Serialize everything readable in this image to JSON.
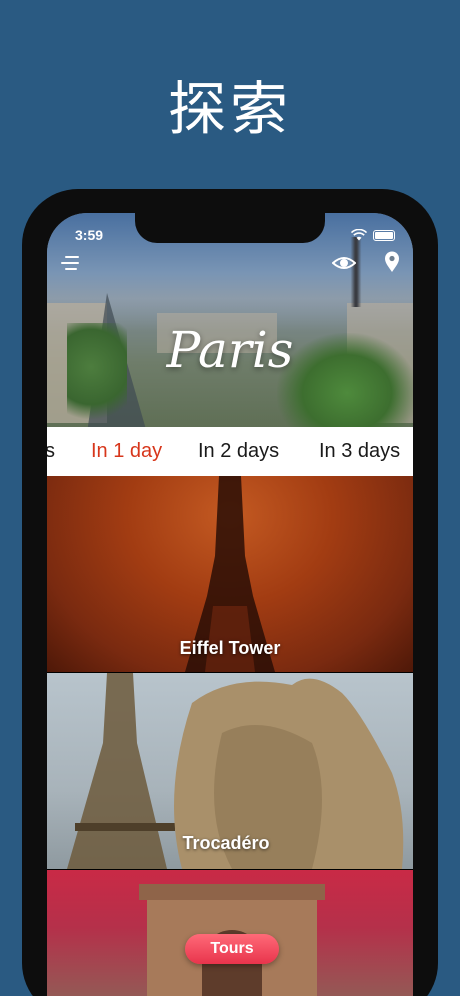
{
  "promo": {
    "title": "探索"
  },
  "status_bar": {
    "time": "3:59"
  },
  "hero": {
    "city": "Paris"
  },
  "tabs": [
    {
      "label": "s"
    },
    {
      "label": "In 1 day",
      "active": true
    },
    {
      "label": "In 2 days"
    },
    {
      "label": "In 3 days"
    }
  ],
  "cards": [
    {
      "label": "Eiffel Tower"
    },
    {
      "label": "Trocadéro"
    },
    {
      "label": ""
    }
  ],
  "tours_button": {
    "label": "Tours"
  },
  "colors": {
    "background": "#2a5a82",
    "accent": "#d7361b",
    "tours": "#e8344c"
  },
  "icons": [
    "menu-icon",
    "eye-icon",
    "location-pin-icon",
    "wifi-icon",
    "battery-icon"
  ]
}
